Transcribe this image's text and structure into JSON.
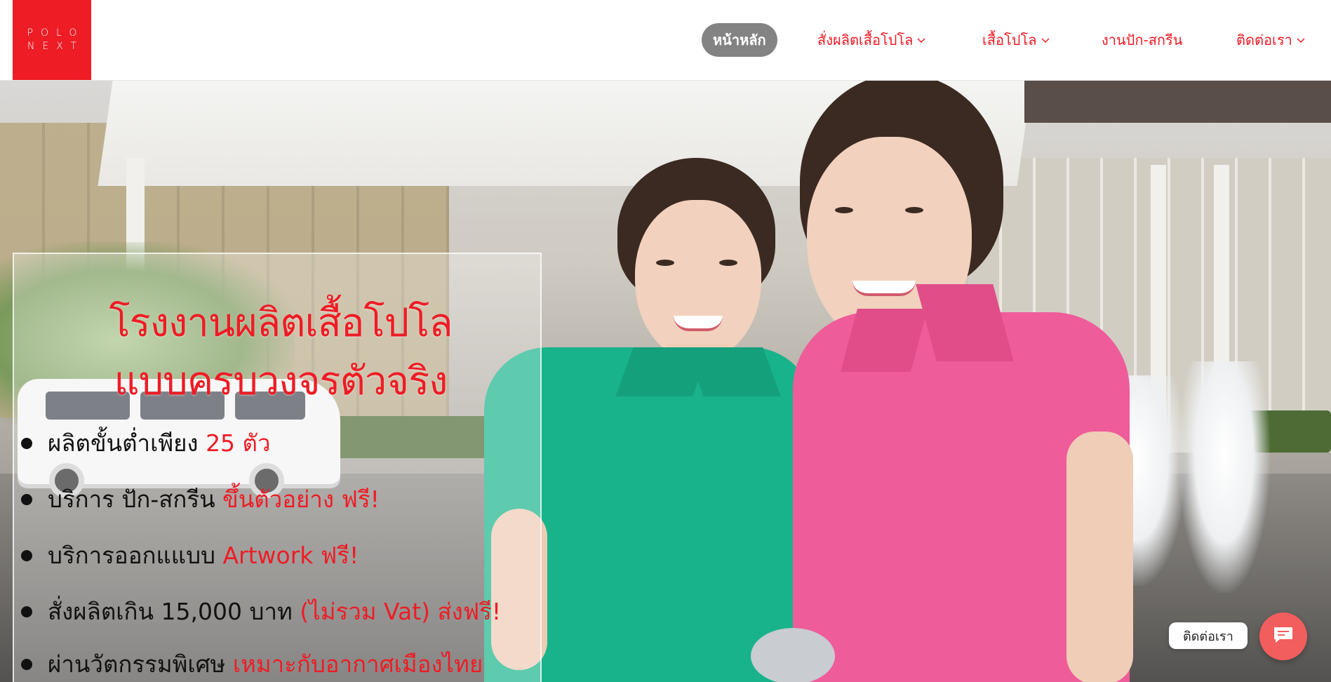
{
  "brand": {
    "line1": "POLO",
    "line2": "NEXT"
  },
  "nav": {
    "items": [
      {
        "label": "หน้าหลัก",
        "has_dropdown": false,
        "active": true
      },
      {
        "label": "สั่งผลิตเสื้อโปโล",
        "has_dropdown": true,
        "active": false
      },
      {
        "label": "เสื้อโปโล",
        "has_dropdown": true,
        "active": false
      },
      {
        "label": "งานปัก-สกรีน",
        "has_dropdown": false,
        "active": false
      },
      {
        "label": "ติดต่อเรา",
        "has_dropdown": true,
        "active": false
      }
    ]
  },
  "hero": {
    "headline_1": "โรงงานผลิตเสื้อโปโล",
    "headline_2": "แบบครบวงจรตัวจริง",
    "bullets": [
      {
        "text": "ผลิตขั้นต่ำเพียง ",
        "highlight": "25 ตัว"
      },
      {
        "text": "บริการ ปัก-สกรีน ",
        "highlight": "ขึ้นตัวอย่าง ฟรี!"
      },
      {
        "text": "บริการออกแแบบ ",
        "highlight": "Artwork ฟรี!"
      },
      {
        "text": "สั่งผลิตเกิน 15,000 บาท ",
        "highlight": "(ไม่รวม Vat) ส่งฟรี!"
      },
      {
        "text": "ผ่านวัตกรรมพิเศษ ",
        "highlight": "เหมาะกับอากาศเมืองไทย"
      }
    ]
  },
  "contact_widget": {
    "label": "ติดต่อเรา",
    "icon": "chat-icon"
  },
  "colors": {
    "brand_red": "#ee1c25",
    "active_nav_bg": "#838383",
    "widget": "#f25d5d"
  }
}
